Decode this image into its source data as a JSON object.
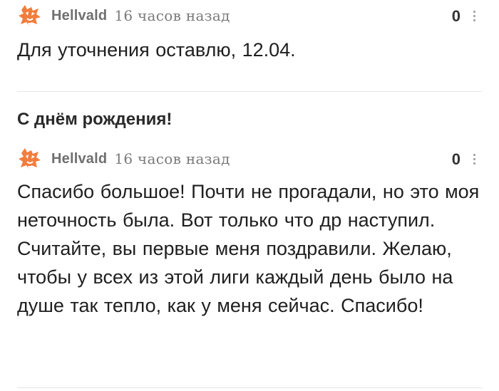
{
  "comments": [
    {
      "author": "Hellvald",
      "time": "16 часов назад",
      "rating": "0",
      "text": "Для уточнения оставлю, 12.04."
    },
    {
      "author": "Hellvald",
      "time": "16 часов назад",
      "rating": "0",
      "text": "Спасибо большое! Почти не прогадали, но это моя неточность была. Вот только что др наступил. Считайте, вы первые меня поздравили. Желаю, чтобы у всех из этой лиги каждый день было на душе так тепло, как у меня сейчас. Спасибо!"
    }
  ],
  "quoted_text": "С днём рождения!",
  "colors": {
    "avatar_orange": "#f47c3c",
    "divider": "#e6e6e6"
  },
  "icons": {
    "avatar": "fox-avatar-icon",
    "more": "more-vertical-icon"
  }
}
